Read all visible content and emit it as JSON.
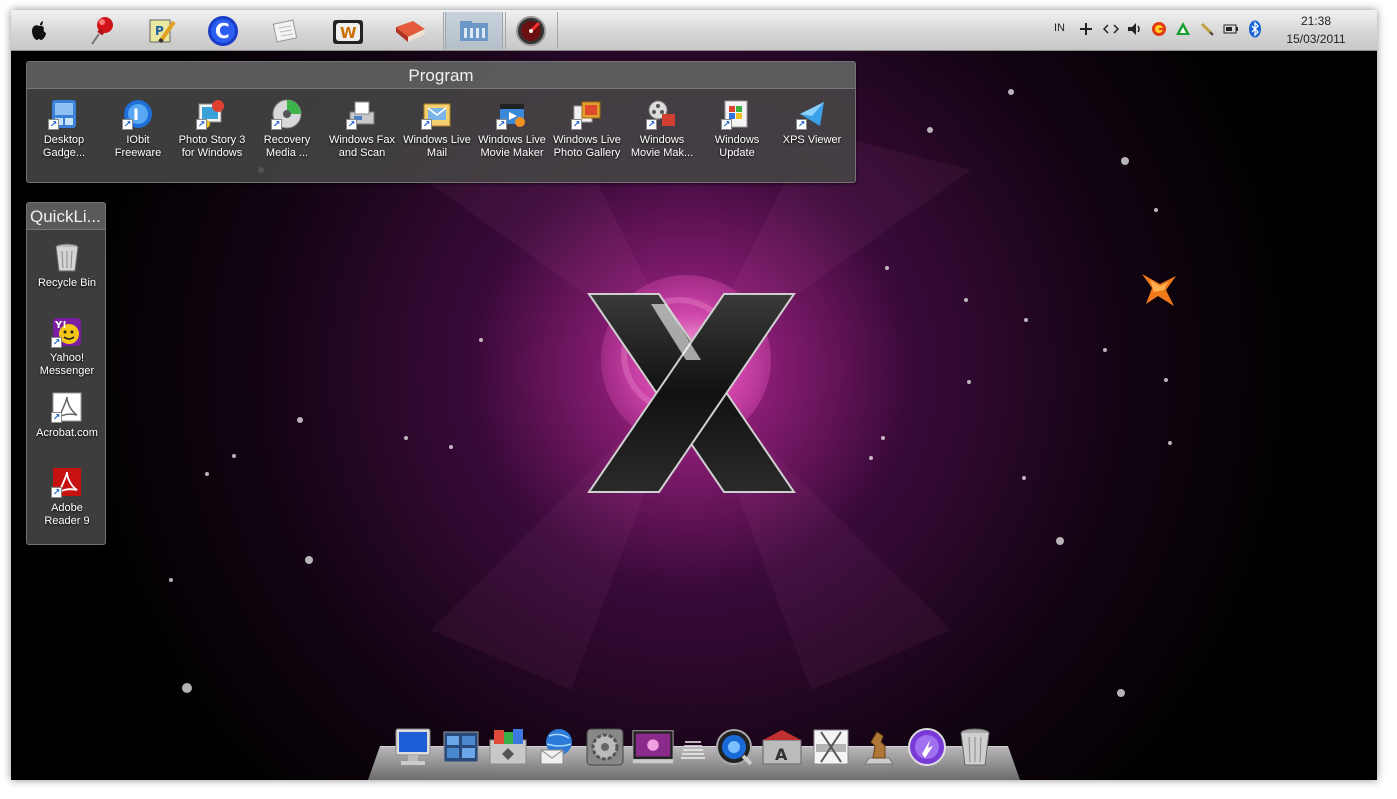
{
  "menubar": {
    "apps": [
      {
        "icon": "apple-logo-icon"
      },
      {
        "icon": "pushpin-icon"
      },
      {
        "icon": "notepad-pencil-icon"
      },
      {
        "icon": "ccleaner-icon"
      },
      {
        "icon": "notes-icon"
      },
      {
        "icon": "winrar-books-icon"
      },
      {
        "icon": "red-book-icon"
      },
      {
        "icon": "library-folder-icon"
      },
      {
        "icon": "speedometer-icon"
      }
    ],
    "tray": {
      "language": "IN",
      "icons": [
        "plus-icon",
        "code-arrows-icon",
        "speaker-icon",
        "red-g-icon",
        "green-triangle-icon",
        "pen-icon",
        "battery-icon",
        "bluetooth-icon"
      ]
    },
    "clock": {
      "time": "21:38",
      "date": "15/03/2011"
    }
  },
  "program_fence": {
    "title": "Program",
    "items": [
      {
        "label": "Desktop\nGadge...",
        "icon": "gadget-icon"
      },
      {
        "label": "IObit\nFreeware",
        "icon": "iobit-icon"
      },
      {
        "label": "Photo Story 3\nfor Windows",
        "icon": "photo-story-icon"
      },
      {
        "label": "Recovery\nMedia ...",
        "icon": "recovery-disc-icon"
      },
      {
        "label": "Windows Fax\nand Scan",
        "icon": "fax-icon"
      },
      {
        "label": "Windows Live\nMail",
        "icon": "live-mail-icon"
      },
      {
        "label": "Windows Live\nMovie Maker",
        "icon": "live-movie-maker-icon"
      },
      {
        "label": "Windows Live\nPhoto Gallery",
        "icon": "photo-gallery-icon"
      },
      {
        "label": "Windows\nMovie Mak...",
        "icon": "movie-maker-icon"
      },
      {
        "label": "Windows\nUpdate",
        "icon": "windows-update-icon"
      },
      {
        "label": "XPS Viewer",
        "icon": "xps-viewer-icon"
      }
    ]
  },
  "quicklinks_fence": {
    "title": "QuickLi...",
    "items": [
      {
        "label": "Recycle Bin",
        "icon": "recycle-bin-icon"
      },
      {
        "label": "Yahoo!\nMessenger",
        "icon": "yahoo-messenger-icon"
      },
      {
        "label": "Acrobat.com",
        "icon": "acrobat-com-icon"
      },
      {
        "label": "Adobe\nReader 9",
        "icon": "adobe-reader-icon"
      }
    ]
  },
  "dock": {
    "items": [
      "computer-monitor-icon",
      "desktop-windows-icon",
      "folders-icon",
      "globe-mail-icon",
      "system-preferences-icon",
      "screen-photo-icon",
      "separator",
      "quicktime-icon",
      "app-store-icon",
      "scissors-tool-icon",
      "chess-icon",
      "purple-orb-icon",
      "trash-can-icon"
    ]
  },
  "colors": {
    "menubar": "#d6d6d6",
    "fence": "#464646",
    "wallpaper_glow": "#c0308f",
    "wallpaper_base": "#000000"
  }
}
